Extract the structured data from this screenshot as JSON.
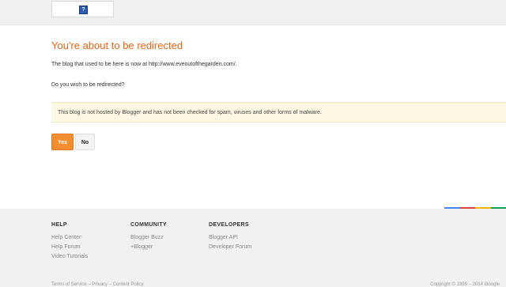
{
  "header": {
    "logo_glyph": "?"
  },
  "main": {
    "title": "You're about to be redirected",
    "message": "The blog that used to be here is now at http://www.eveoutofthegarden.com/.",
    "question": "Do you wish to be redirected?",
    "warning": "This blog is not hosted by Blogger and has not been checked for spam, viruses and other forms of malware.",
    "yes_label": "Yes",
    "no_label": "No"
  },
  "footer": {
    "help": {
      "heading": "HELP",
      "links": [
        "Help Center",
        "Help Forum",
        "Video Tutorials"
      ]
    },
    "community": {
      "heading": "COMMUNITY",
      "links": [
        "Blogger Buzz",
        "+Blogger"
      ]
    },
    "developers": {
      "heading": "DEVELOPERS",
      "links": [
        "Blogger API",
        "Developer Forum"
      ]
    },
    "legal_links": [
      "Terms of Service",
      "Privacy",
      "Content Policy"
    ],
    "copyright": "Copyright © 1999 – 2014 Google"
  },
  "colors": {
    "accent": "#e2661a",
    "yes_button": "#f48d2f",
    "warning_bg": "#fdf8e4",
    "colorbar": [
      "#4285f4",
      "#db4437",
      "#f4b400",
      "#0f9d58"
    ]
  }
}
